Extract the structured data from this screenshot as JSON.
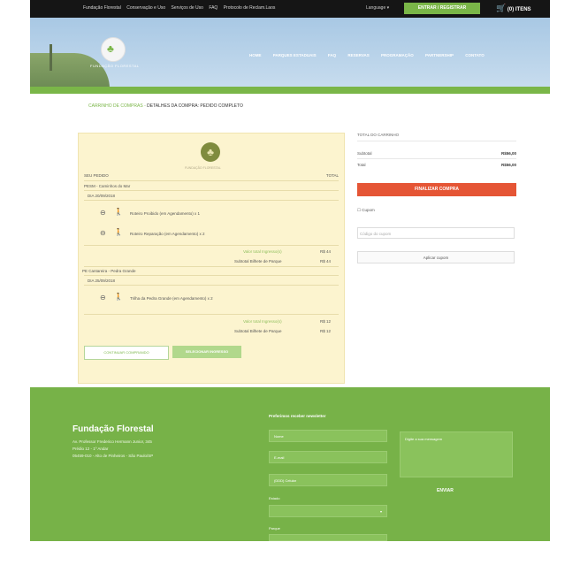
{
  "topbar": {
    "links": [
      "Fundação Florestal",
      "Conservação e Uso",
      "Serviços de Uso",
      "FAQ",
      "Protocolo de Reclam.Laos"
    ],
    "language": "Language ▾",
    "action_label": "ENTRAR / REGISTRAR",
    "cart_label": "(0) ITENS"
  },
  "header": {
    "logo_text": "FUNDAÇÃO FLORESTAL",
    "nav": [
      "HOME",
      "PARQUES ESTADUAIS",
      "FAQ",
      "RESERVAS",
      "PROGRAMAÇÃO",
      "PARTNERSHIP",
      "CONTATO"
    ]
  },
  "breadcrumb": {
    "link": "CARRINHO DE COMPRAS",
    "separator": " - ",
    "current": "DETALHES DA COMPRA: PEDIDO COMPLETO"
  },
  "cart": {
    "logo_text": "FUNDAÇÃO FLORESTAL",
    "col_left": "SEU PEDIDO",
    "col_right": "TOTAL",
    "groups": [
      {
        "park": "PESM - Caminhos do Mar",
        "date": "DIA 20/09/2018",
        "items": [
          "Roteiro Proibido (em Agendamento) x 1",
          "Roteiro Reparação (em Agendamento) x 2"
        ],
        "sub_label": "Valor total Ingresso(s)",
        "sub_value": "R$ 44",
        "subtot_label": "Subtotal Bilhete de Parque",
        "subtot_value": "R$ 44"
      },
      {
        "park": "PE Cantareira - Pedra Grande",
        "date": "DIA 25/09/2018",
        "items": [
          "Trilha da Pedra Grande (em Agendamento) x 2"
        ],
        "sub_label": "Valor total Ingresso(s)",
        "sub_value": "R$ 12",
        "subtot_label": "Subtotal Bilhete de Parque",
        "subtot_value": "R$ 12"
      }
    ],
    "continue_label": "CONTINUAR COMPRANDO",
    "select_label": "SELECIONAR INGRESSO"
  },
  "totals": {
    "title": "TOTAL DO CARRINHO",
    "subtotal_label": "Subtotal",
    "subtotal_value": "R$56,00",
    "total_label": "Total",
    "total_value": "R$56,00",
    "finalize_label": "FINALIZAR COMPRA",
    "coupon_label": "☐ Cupom",
    "coupon_placeholder": "Código do cupom",
    "apply_label": "Aplicar cupom"
  },
  "footer": {
    "name": "Fundação Florestal",
    "address_lines": [
      "Av. Professor Frederico Hermann Junior, 345",
      "Prédio 12 - 1º Andar",
      "05459-010 - Alto de Pinheiros - São Paulo/SP"
    ],
    "newsletter_title": "Preferimos receber newsletter",
    "name_field": "Nome",
    "email_field": "E-mail",
    "phone_field": "(DDD) Celular",
    "state_label": "Estado",
    "state_value": "",
    "park_label": "Parque",
    "message_placeholder": "Digite a sua mensagem",
    "send_label": "ENVIAR"
  },
  "colors": {
    "green": "#7ab648",
    "orange": "#e55535",
    "cream": "#fcf4cf"
  }
}
